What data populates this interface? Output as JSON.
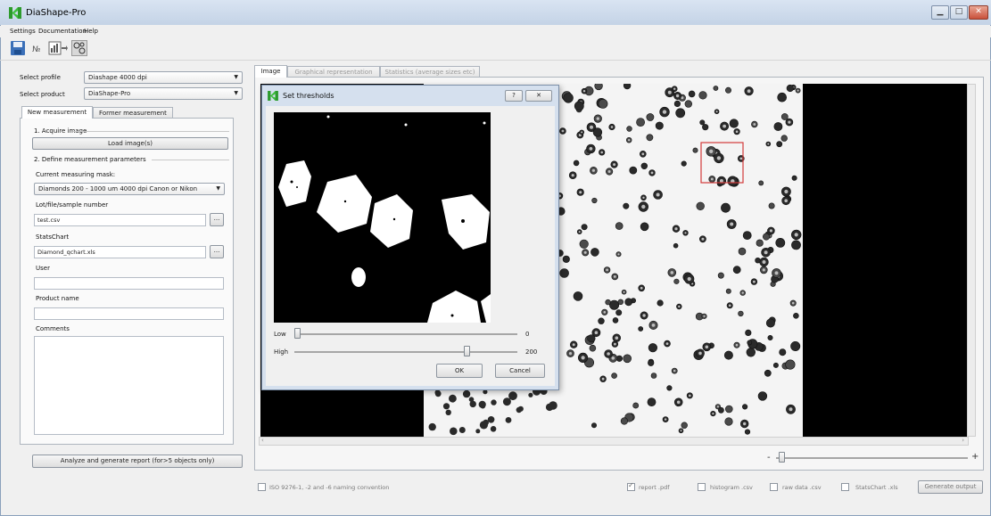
{
  "window": {
    "title": "DiaShape-Pro",
    "buttons": [
      "minimize",
      "maximize",
      "close"
    ]
  },
  "menu": [
    "Settings",
    "Documentation",
    "Help"
  ],
  "toolbar": {
    "icons": [
      "save-icon",
      "numbering-icon",
      "chart-export-icon",
      "objects-icon"
    ]
  },
  "left": {
    "profile_label": "Select profile",
    "profile_value": "Diashape 4000 dpi",
    "product_label": "Select product",
    "product_value": "DiaShape-Pro",
    "tabs": [
      "New measurement",
      "Former measurement"
    ],
    "acquire_title": "1. Acquire image",
    "load_button": "Load image(s)",
    "params_title": "2. Define measurement parameters",
    "mask_label": "Current measuring mask:",
    "mask_value": "Diamonds 200 - 1000 um 4000 dpi Canon or Nikon",
    "lot_label": "Lot/file/sample number",
    "lot_value": "test.csv",
    "browse": "...",
    "statschart_label": "StatsChart",
    "statschart_value": "Diamond_qchart.xls",
    "user_label": "User",
    "user_value": "",
    "product_name_label": "Product name",
    "product_name_value": "",
    "comments_label": "Comments",
    "comments_value": "",
    "analyze_button": "Analyze and generate report (for>5 objects only)"
  },
  "right": {
    "tabs": [
      "Image",
      "Graphical representation",
      "Statistics (average sizes etc)"
    ],
    "zoom_minus": "-",
    "zoom_plus": "+",
    "iso_label": "ISO 9276-1, -2 and -6 naming convention",
    "outputs": [
      {
        "label": "report .pdf",
        "checked": true
      },
      {
        "label": "histogram .csv",
        "checked": false
      },
      {
        "label": "raw data .csv",
        "checked": false
      },
      {
        "label": "StatsChart .xls",
        "checked": false
      }
    ],
    "generate_button": "Generate output",
    "scroll_left": "‹",
    "scroll_right": "›"
  },
  "dialog": {
    "title": "Set thresholds",
    "help": "?",
    "close": "✕",
    "low_label": "Low",
    "low_value": "0",
    "low_level": 0,
    "high_label": "High",
    "high_value": "200",
    "high_level": 0.78,
    "ok": "OK",
    "cancel": "Cancel"
  }
}
